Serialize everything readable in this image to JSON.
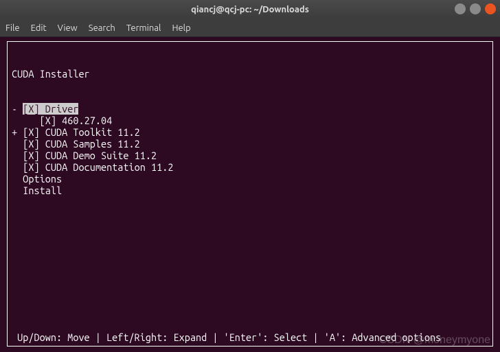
{
  "window": {
    "title": "qiancj@qcj-pc: ~/Downloads"
  },
  "menubar": {
    "items": [
      "File",
      "Edit",
      "View",
      "Search",
      "Terminal",
      "Help"
    ]
  },
  "installer": {
    "heading": "CUDA Installer",
    "lines": [
      {
        "prefix": "- ",
        "check": "[X]",
        "label": " Driver",
        "highlighted": true
      },
      {
        "prefix": "     ",
        "check": "[X]",
        "label": " 460.27.04",
        "highlighted": false
      },
      {
        "prefix": "+ ",
        "check": "[X]",
        "label": " CUDA Toolkit 11.2",
        "highlighted": false
      },
      {
        "prefix": "  ",
        "check": "[X]",
        "label": " CUDA Samples 11.2",
        "highlighted": false
      },
      {
        "prefix": "  ",
        "check": "[X]",
        "label": " CUDA Demo Suite 11.2",
        "highlighted": false
      },
      {
        "prefix": "  ",
        "check": "[X]",
        "label": " CUDA Documentation 11.2",
        "highlighted": false
      },
      {
        "prefix": "  ",
        "check": "",
        "label": "Options",
        "highlighted": false
      },
      {
        "prefix": "  ",
        "check": "",
        "label": "Install",
        "highlighted": false
      }
    ],
    "footer": " Up/Down: Move | Left/Right: Expand | 'Enter': Select | 'A': Advanced options"
  },
  "watermark": "CSDN @moneymyone"
}
